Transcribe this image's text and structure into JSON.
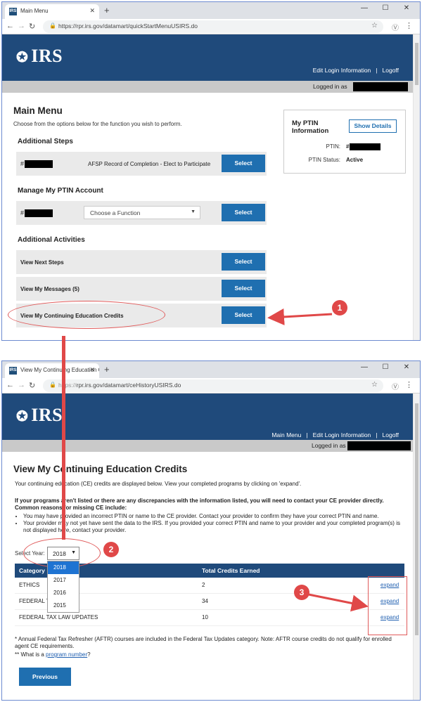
{
  "window1": {
    "tab_title": "Main Menu",
    "url": "https://rpr.irs.gov/datamart/quickStartMenuUSIRS.do",
    "logo_text": "IRS",
    "nav": {
      "edit_login": "Edit Login Information",
      "logoff": "Logoff"
    },
    "logged_in": "Logged in as",
    "page_title": "Main Menu",
    "intro": "Choose from the options below for the function you wish to perform.",
    "additional_steps": {
      "heading": "Additional Steps",
      "hash": "#",
      "label": "AFSP Record of Completion - Elect to Participate",
      "button": "Select"
    },
    "manage_ptin": {
      "heading": "Manage My PTIN Account",
      "hash": "#",
      "select_placeholder": "Choose a Function",
      "button": "Select"
    },
    "additional_activities": {
      "heading": "Additional Activities",
      "items": [
        {
          "label": "View Next Steps",
          "button": "Select"
        },
        {
          "label": "View My Messages  (5)",
          "button": "Select"
        },
        {
          "label": "View My Continuing Education Credits",
          "button": "Select"
        }
      ]
    },
    "ptin_box": {
      "heading": "My PTIN Information",
      "show_details": "Show Details",
      "ptin_label": "PTIN:",
      "ptin_value": "#",
      "status_label": "PTIN Status:",
      "status_value": "Active"
    }
  },
  "window2": {
    "tab_title": "View My Continuing Education C",
    "url_prefix": "https://",
    "url_rest": "rpr.irs.gov/datamart/ceHistoryUSIRS.do",
    "logo_text": "IRS",
    "nav": {
      "main_menu": "Main Menu",
      "edit_login": "Edit Login Information",
      "logoff": "Logoff"
    },
    "logged_in": "Logged in as",
    "page_title": "View My Continuing Education Credits",
    "intro": "Your continuing education (CE) credits are displayed below. View your completed programs by clicking on 'expand'.",
    "warning_line1": "If your programs aren't listed or there are any discrepancies with the information listed, you will need to contact your CE provider directly.",
    "warning_line2": "Common reasons for missing CE include:",
    "bullets": [
      "You may have provided an incorrect PTIN or name to the CE provider. Contact your provider to confirm they have your correct PTIN and name.",
      "Your provider may not yet have sent the data to the IRS. If you provided your correct PTIN and name to your provider and your completed program(s) is not displayed here, contact your provider."
    ],
    "select_year_label": "Select Year:",
    "selected_year": "2018",
    "year_options": [
      "2018",
      "2017",
      "2016",
      "2015"
    ],
    "table": {
      "headers": [
        "Category",
        "Total Credits Earned"
      ],
      "rows": [
        {
          "category": "ETHICS",
          "credits": "2",
          "action": "expand"
        },
        {
          "category": "FEDERAL T",
          "credits": "34",
          "action": "expand"
        },
        {
          "category": "FEDERAL TAX LAW UPDATES",
          "credits": "10",
          "action": "expand"
        }
      ]
    },
    "footnote1": "* Annual Federal Tax Refresher (AFTR) courses are included in the Federal Tax Updates category. Note: AFTR course credits do not qualify for enrolled agent CE requirements.",
    "footnote2_pre": "** What is a ",
    "footnote2_link": "program number",
    "footnote2_post": "?",
    "previous_button": "Previous"
  },
  "annotations": {
    "badge1": "1",
    "badge2": "2",
    "badge3": "3"
  },
  "colors": {
    "irs_blue": "#1f4a7b",
    "button_blue": "#1f6fb0",
    "annotation_red": "#e04848"
  }
}
